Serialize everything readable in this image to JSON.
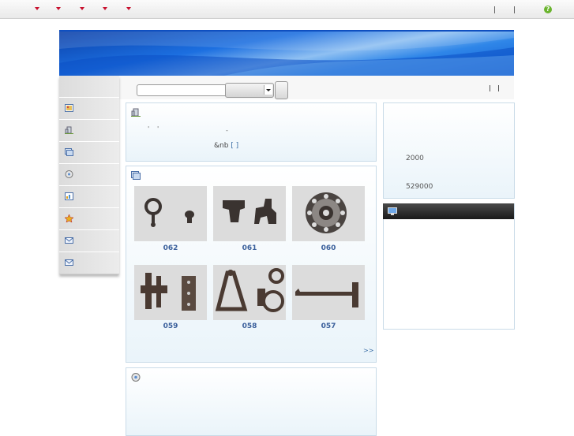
{
  "topbar": {
    "menu_items": [
      {
        "icon": "dropdown-triangle-icon",
        "color": "#c8102e"
      },
      {
        "icon": "dropdown-triangle-icon",
        "color": "#c8102e"
      },
      {
        "icon": "dropdown-triangle-icon",
        "color": "#c8102e"
      },
      {
        "icon": "dropdown-triangle-icon",
        "color": "#c8102e"
      },
      {
        "icon": "dropdown-triangle-icon",
        "color": "#c8102e"
      }
    ],
    "help_icon": "help-icon",
    "help_glyph": "?"
  },
  "search": {
    "input_value": "",
    "select_value": ""
  },
  "sidebar": {
    "items": [
      {
        "icon": "picture-icon"
      },
      {
        "icon": "building-icon"
      },
      {
        "icon": "gallery-icon"
      },
      {
        "icon": "disc-icon"
      },
      {
        "icon": "document-chart-icon"
      },
      {
        "icon": "award-icon"
      },
      {
        "icon": "mail-icon"
      },
      {
        "icon": "mail-icon"
      }
    ]
  },
  "intro": {
    "icon": "building-icon",
    "text_line1_a": "'",
    "text_line1_b": "'",
    "text_line2": "-",
    "link_text": "&nb",
    "more_bracket": "[ ]"
  },
  "products": {
    "icon": "gallery-icon",
    "items": [
      {
        "label": "062"
      },
      {
        "label": "061"
      },
      {
        "label": "060"
      },
      {
        "label": "059"
      },
      {
        "label": "058"
      },
      {
        "label": "057"
      }
    ],
    "more": ">>"
  },
  "news": {
    "icon": "disc-icon"
  },
  "stats": {
    "value1": "2000",
    "value2": "529000"
  },
  "contact_bar": {
    "icon": "monitor-icon"
  },
  "colors": {
    "accent_blue": "#1c6fe0",
    "label_blue": "#3a5f9b",
    "panel_border": "#c9dbe8",
    "dark_bar": "#1a1a1a"
  }
}
